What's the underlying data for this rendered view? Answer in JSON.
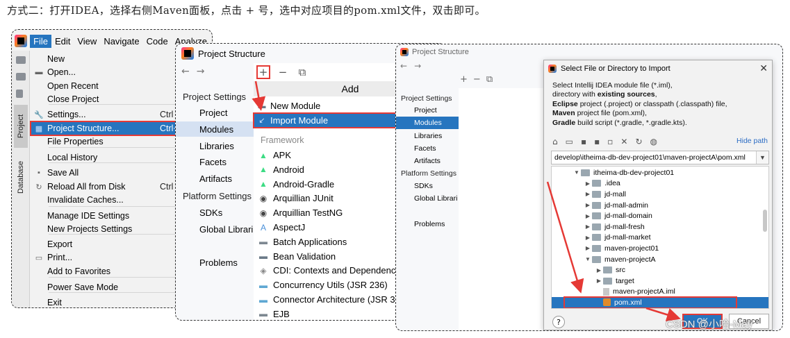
{
  "caption": "方式二：打开IDEA，选择右侧Maven面板，点击 + 号，选中对应项目的pom.xml文件，双击即可。",
  "shot1": {
    "menubar": [
      "File",
      "Edit",
      "View",
      "Navigate",
      "Code",
      "Analyze"
    ],
    "tool_tabs": [
      "Project",
      "Database"
    ],
    "menu_items": [
      {
        "label": "New",
        "icon": "none",
        "shortcut": ""
      },
      {
        "label": "Open...",
        "icon": "folder-icon",
        "shortcut": ""
      },
      {
        "label": "Open Recent",
        "icon": "none",
        "shortcut": ""
      },
      {
        "label": "Close Project",
        "icon": "none",
        "shortcut": ""
      },
      {
        "label": "Settings...",
        "icon": "wrench-icon",
        "shortcut": "Ctrl"
      },
      {
        "label": "Project Structure...",
        "icon": "project-structure-icon",
        "shortcut": "Ctrl+Alt+S"
      },
      {
        "label": "File Properties",
        "icon": "none",
        "shortcut": ""
      },
      {
        "label": "Local History",
        "icon": "none",
        "shortcut": ""
      },
      {
        "label": "Save All",
        "icon": "save-icon",
        "shortcut": ""
      },
      {
        "label": "Reload All from Disk",
        "icon": "reload-icon",
        "shortcut": "Ctrl"
      },
      {
        "label": "Invalidate Caches...",
        "icon": "none",
        "shortcut": ""
      },
      {
        "label": "Manage IDE Settings",
        "icon": "none",
        "shortcut": ""
      },
      {
        "label": "New Projects Settings",
        "icon": "none",
        "shortcut": ""
      },
      {
        "label": "Export",
        "icon": "none",
        "shortcut": ""
      },
      {
        "label": "Print...",
        "icon": "print-icon",
        "shortcut": ""
      },
      {
        "label": "Add to Favorites",
        "icon": "none",
        "shortcut": ""
      },
      {
        "label": "Power Save Mode",
        "icon": "none",
        "shortcut": ""
      },
      {
        "label": "Exit",
        "icon": "none",
        "shortcut": ""
      }
    ]
  },
  "shot2": {
    "title": "Project Structure",
    "project_settings_header": "Project Settings",
    "project_settings": [
      "Project",
      "Modules",
      "Libraries",
      "Facets",
      "Artifacts"
    ],
    "platform_settings_header": "Platform Settings",
    "platform_settings": [
      "SDKs",
      "Global Librari"
    ],
    "problems": "Problems",
    "add_popup_title": "Add",
    "add_items": [
      "New Module",
      "Import Module"
    ],
    "framework_header": "Framework",
    "frameworks": [
      "APK",
      "Android",
      "Android-Gradle",
      "Arquillian JUnit",
      "Arquillian TestNG",
      "AspectJ",
      "Batch Applications",
      "Bean Validation",
      "CDI: Contexts and Dependenc",
      "Concurrency Utils (JSR 236)",
      "Connector Architecture (JSR 3",
      "EJB"
    ]
  },
  "shot3": {
    "bg_title": "Project Structure",
    "project_settings_header": "Project Settings",
    "project_settings": [
      "Project",
      "Modules",
      "Libraries",
      "Facets",
      "Artifacts"
    ],
    "platform_settings_header": "Platform Settings",
    "platform_settings": [
      "SDKs",
      "Global Librari"
    ],
    "problems": "Problems",
    "dialog": {
      "title": "Select File or Directory to Import",
      "desc_line1": "Select Intellij IDEA module file (*.iml),",
      "desc_line2_pre": "directory with ",
      "desc_line2_bold": "existing sources",
      "desc_line2_post": ",",
      "desc_line3_bold": "Eclipse",
      "desc_line3_post": " project (.project) or classpath (.classpath) file,",
      "desc_line4_bold": "Maven",
      "desc_line4_post": " project file (pom.xml),",
      "desc_line5_bold": "Gradle",
      "desc_line5_post": " build script (*.gradle, *.gradle.kts).",
      "hide_path": "Hide path",
      "path": "develop\\itheima-db-dev-project01\\maven-projectA\\pom.xml",
      "tree": [
        {
          "label": "itheima-db-dev-project01",
          "level": 0,
          "arrow": "down",
          "kind": "folder"
        },
        {
          "label": ".idea",
          "level": 1,
          "arrow": "right",
          "kind": "folder"
        },
        {
          "label": "jd-mall",
          "level": 1,
          "arrow": "right",
          "kind": "folder"
        },
        {
          "label": "jd-mall-admin",
          "level": 1,
          "arrow": "right",
          "kind": "folder"
        },
        {
          "label": "jd-mall-domain",
          "level": 1,
          "arrow": "right",
          "kind": "folder"
        },
        {
          "label": "jd-mall-fresh",
          "level": 1,
          "arrow": "right",
          "kind": "folder"
        },
        {
          "label": "jd-mall-market",
          "level": 1,
          "arrow": "right",
          "kind": "folder"
        },
        {
          "label": "maven-project01",
          "level": 1,
          "arrow": "right",
          "kind": "folder"
        },
        {
          "label": "maven-projectA",
          "level": 1,
          "arrow": "down",
          "kind": "folder"
        },
        {
          "label": "src",
          "level": 2,
          "arrow": "right",
          "kind": "folder"
        },
        {
          "label": "target",
          "level": 2,
          "arrow": "right",
          "kind": "folder"
        },
        {
          "label": "maven-projectA.iml",
          "level": 2,
          "arrow": "",
          "kind": "file"
        },
        {
          "label": "pom.xml",
          "level": 2,
          "arrow": "",
          "kind": "xml"
        }
      ],
      "ok": "OK",
      "cancel": "Cancel",
      "help": "?"
    }
  },
  "watermark": "CSDN @小哈-May",
  "colors": {
    "accent": "#2675bf",
    "highlight_border": "#e53935"
  }
}
